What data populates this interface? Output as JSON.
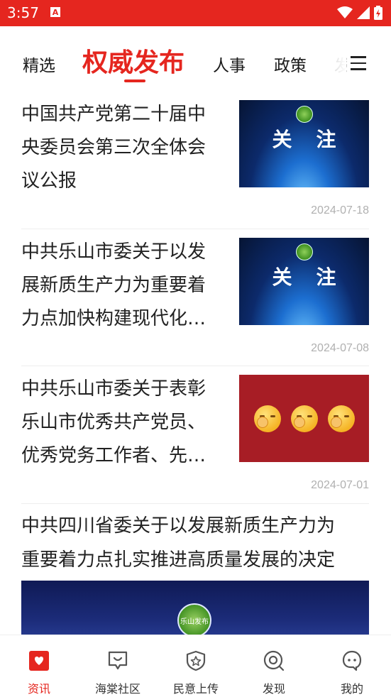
{
  "status_bar": {
    "time": "3:57",
    "notification_badge": "A"
  },
  "tabs": [
    {
      "label": "精选",
      "active": false
    },
    {
      "label": "权威发布",
      "active": true
    },
    {
      "label": "人事",
      "active": false
    },
    {
      "label": "政策",
      "active": false
    },
    {
      "label": "发",
      "active": false
    }
  ],
  "news": [
    {
      "title_lines": [
        "中国共产党第二十届中",
        "央委员会第三次全体会",
        "议公报"
      ],
      "thumb_text": "关注",
      "date": "2024-07-18"
    },
    {
      "title_lines": [
        "中共乐山市委关于以发",
        "展新质生产力为重要着",
        "力点加快构建现代化…"
      ],
      "thumb_text": "关注",
      "date": "2024-07-08"
    },
    {
      "title_lines": [
        "中共乐山市委关于表彰",
        "乐山市优秀共产党员、",
        "优秀党务工作者、先…"
      ],
      "date": "2024-07-01"
    }
  ],
  "featured": {
    "title_lines": [
      "中共四川省委关于以发展新质生产力为",
      "重要着力点扎实推进高质量发展的决定"
    ],
    "image_logo": "乐山发布"
  },
  "bottom_nav": [
    {
      "label": "资讯",
      "active": true
    },
    {
      "label": "海棠社区",
      "active": false
    },
    {
      "label": "民意上传",
      "active": false
    },
    {
      "label": "发现",
      "active": false
    },
    {
      "label": "我的",
      "active": false
    }
  ],
  "colors": {
    "brand_red": "#e5261f",
    "date_gray": "#b0b0b0"
  }
}
